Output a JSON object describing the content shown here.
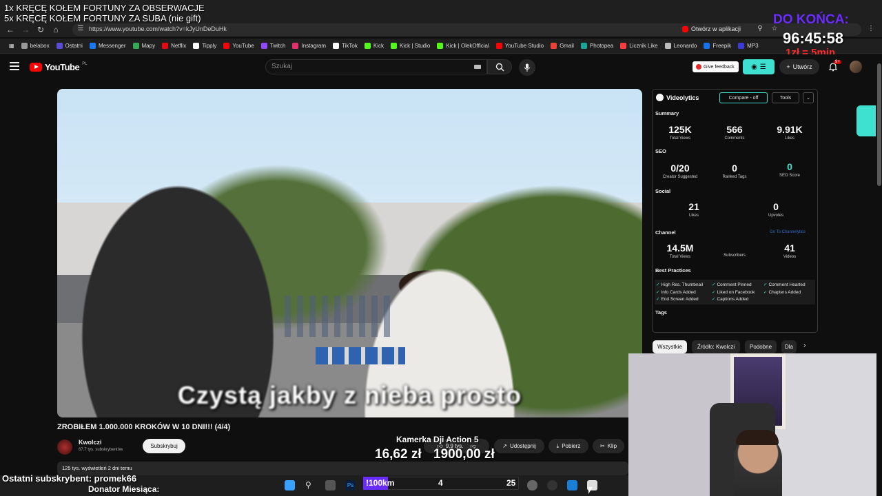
{
  "overlay": {
    "lines": [
      "1x KRĘCĘ KOŁEM FORTUNY ZA OBSERWACJE",
      "5x KRĘCĘ KOŁEM FORTUNY ZA SUBA (nie gift)"
    ],
    "countdown_label": "DO KOŃCA:",
    "countdown": "96:45:58",
    "rate": "1zł = 5min",
    "last_sub": "Ostatni subskrybent: promek66",
    "donator": "Donator Miesiąca:"
  },
  "browser": {
    "url": "https://www.youtube.com/watch?v=kJyUnDeDuHk",
    "open_in_app": "Otwórz w aplikacji",
    "bookmarks": [
      {
        "label": "belabox",
        "color": "#9a9a9a"
      },
      {
        "label": "Ostatni",
        "color": "#5b4bd6"
      },
      {
        "label": "Messenger",
        "color": "#1877f2"
      },
      {
        "label": "Mapy",
        "color": "#34a853"
      },
      {
        "label": "Netflix",
        "color": "#e50914"
      },
      {
        "label": "Tipply",
        "color": "#ffffff"
      },
      {
        "label": "YouTube",
        "color": "#ff0000"
      },
      {
        "label": "Twitch",
        "color": "#9146ff"
      },
      {
        "label": "Instagram",
        "color": "#e1306c"
      },
      {
        "label": "TikTok",
        "color": "#ffffff"
      },
      {
        "label": "Kick",
        "color": "#53fc18"
      },
      {
        "label": "Kick | Studio",
        "color": "#53fc18"
      },
      {
        "label": "Kick | OlekOfficial",
        "color": "#53fc18"
      },
      {
        "label": "YouTube Studio",
        "color": "#ff0000"
      },
      {
        "label": "Gmail",
        "color": "#ea4335"
      },
      {
        "label": "Photopea",
        "color": "#18a497"
      },
      {
        "label": "Licznik Like",
        "color": "#ff3b3b"
      },
      {
        "label": "Leonardo",
        "color": "#bbbbbb"
      },
      {
        "label": "Freepik",
        "color": "#1273eb"
      },
      {
        "label": "MP3",
        "color": "#3b3bd6"
      }
    ]
  },
  "youtube": {
    "logo": "YouTube",
    "country": "PL",
    "search_placeholder": "Szukaj",
    "feedback": "Give feedback",
    "create": "Utwórz",
    "notifications": "9+"
  },
  "video": {
    "subtitle": "Czystą jakby z nieba prosto",
    "title": "ZROBIŁEM 1.000.000 KROKÓW W 10 DNI!!! (4/4)",
    "channel": "Kwolczi",
    "subscribers": "67,7 tys. subskrybentów",
    "subscribe": "Subskrybuj",
    "likes": "9,9 tys.",
    "share": "Udostępnij",
    "download": "Pobierz",
    "clip": "Klip",
    "meta": "125 tys. wyświetleń  2 dni temu"
  },
  "donation": {
    "title": "Kamerka Dji Action 5",
    "current": "16,62 zł",
    "goal": "1900,00 zł"
  },
  "videolytics": {
    "name": "Videolytics",
    "compare": "Compare - off",
    "tools": "Tools",
    "summary": "Summary",
    "total_views": "125K",
    "total_views_label": "Total Views",
    "comments": "566",
    "comments_label": "Comments",
    "likes": "9.91K",
    "likes_label": "Likes",
    "seo": "SEO",
    "creator_suggested": "0/20",
    "creator_suggested_label": "Creator Suggested",
    "ranked_tags": "0",
    "ranked_tags_label": "Ranked Tags",
    "seo_score": "0",
    "seo_score_label": "SEO Score",
    "social": "Social",
    "social_likes": "21",
    "social_likes_label": "Likes",
    "upvotes": "0",
    "upvotes_label": "Upvotes",
    "channel": "Channel",
    "goto": "Go To Channelytics",
    "channel_views": "14.5M",
    "channel_views_label": "Total Views",
    "subscribers_label": "Subscribers",
    "videos": "41",
    "videos_label": "Videos",
    "best_practices": "Best Practices",
    "bp": [
      "High Res. Thumbnail",
      "Comment Pinned",
      "Comment Hearted",
      "Info Cards Added",
      "Liked on Facebook",
      "Chapters Added",
      "End Screen Added",
      "Captions Added"
    ],
    "tags": "Tags"
  },
  "chips": {
    "all": "Wszystkie",
    "source": "Źródło: Kwolczi",
    "similar": "Podobne",
    "for_you": "Dla"
  },
  "km": {
    "label": "!100km",
    "current": "4",
    "goal": "25",
    "progress": 0.16
  }
}
